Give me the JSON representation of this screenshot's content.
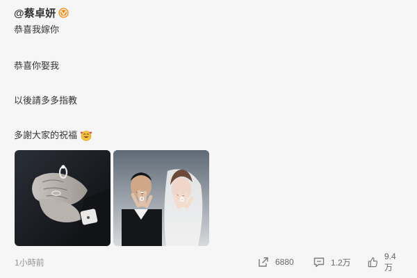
{
  "post": {
    "username": "@蔡卓妍",
    "lines": [
      "恭喜我嫁你",
      "恭喜你娶我",
      "以後請多多指教",
      "多謝大家的祝福"
    ],
    "emoji": "smiling-face-with-hearts-icon",
    "timestamp": "1小時前",
    "stats": {
      "reposts": "6880",
      "comments": "1.2万",
      "likes": "9.4万"
    }
  },
  "colors": {
    "background": "#f6f6f6",
    "text": "#333333",
    "muted": "#939393",
    "verified": "#ff8200"
  }
}
